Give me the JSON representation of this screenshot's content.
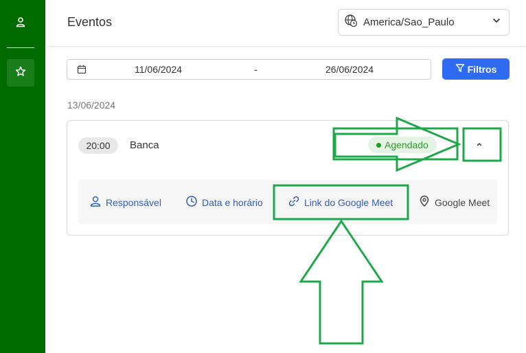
{
  "sidebar": {
    "items": [
      {
        "icon": "user-icon"
      },
      {
        "icon": "star-icon"
      }
    ]
  },
  "header": {
    "title": "Eventos",
    "timezone": "America/Sao_Paulo"
  },
  "filters": {
    "start_date": "11/06/2024",
    "separator": "-",
    "end_date": "26/06/2024",
    "button_label": "Filtros"
  },
  "events": {
    "date_heading": "13/06/2024",
    "items": [
      {
        "time": "20:00",
        "name": "Banca",
        "status": "Agendado",
        "details": {
          "responsavel": "Responsável",
          "data_horario": "Data e horário",
          "meet_link": "Link do Google Meet",
          "location": "Google Meet"
        }
      }
    ]
  },
  "annotations": {
    "highlight_color": "#1fa84a",
    "shapes": [
      "highlight-box-status",
      "highlight-box-collapse",
      "highlight-box-meet-link",
      "arrow-right",
      "arrow-up"
    ]
  },
  "colors": {
    "sidebar": "#006b00",
    "primary_button": "#2f6bf1",
    "link": "#2f5fbf",
    "status_bg": "#e4f4e4",
    "status_text": "#2e9a2e"
  }
}
